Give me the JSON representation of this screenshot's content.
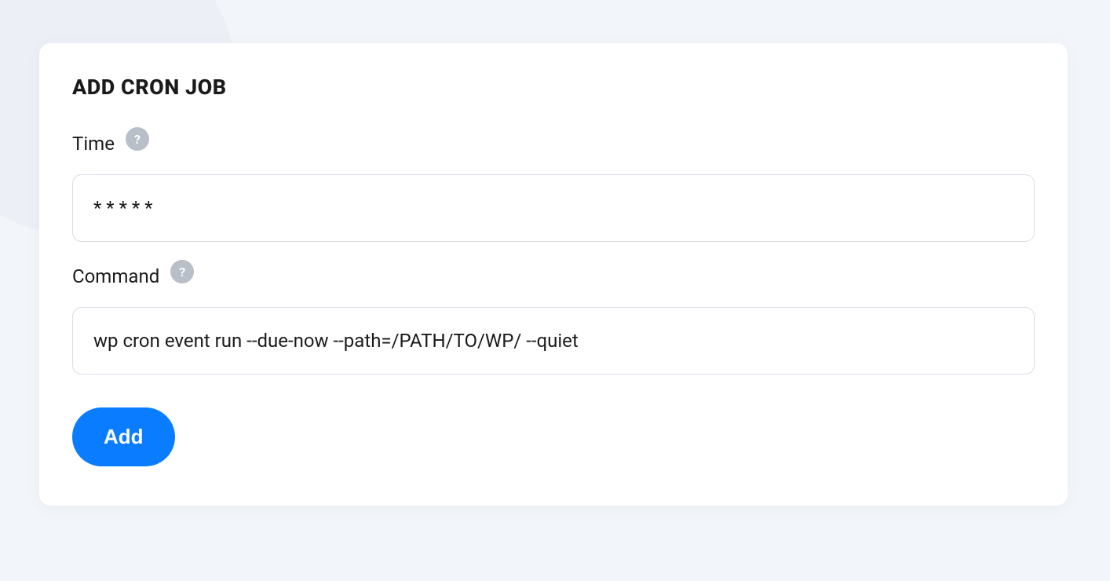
{
  "card": {
    "title": "ADD CRON JOB"
  },
  "fields": {
    "time": {
      "label": "Time",
      "value": "* * * * *",
      "help_icon": "?"
    },
    "command": {
      "label": "Command",
      "value": "wp cron event run --due-now --path=/PATH/TO/WP/ --quiet",
      "help_icon": "?"
    }
  },
  "buttons": {
    "submit": "Add"
  }
}
